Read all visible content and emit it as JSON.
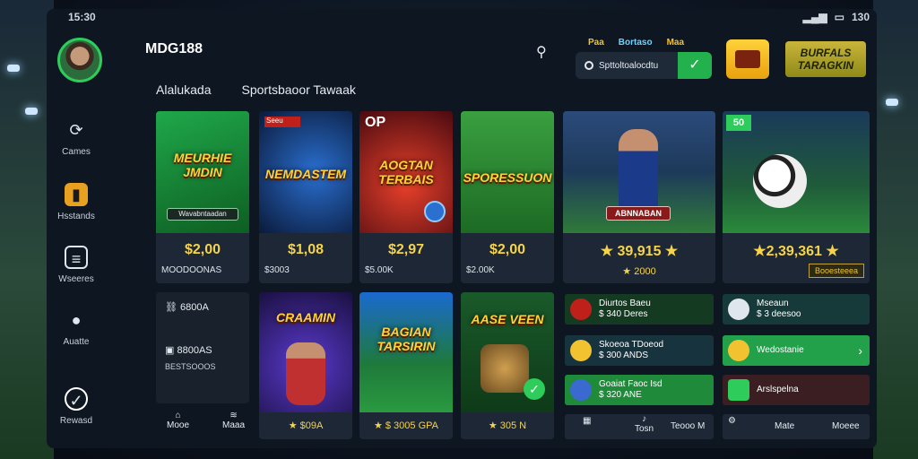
{
  "status": {
    "time": "15:30",
    "battery": "130"
  },
  "sidebar": {
    "items": [
      {
        "label": "Cames",
        "icon": "refresh-icon"
      },
      {
        "label": "Hsstands",
        "icon": "chart-icon"
      },
      {
        "label": "Wseeres",
        "icon": "list-icon"
      },
      {
        "label": "Auatte",
        "icon": "user-icon"
      },
      {
        "label": "Rewasd",
        "icon": "check-circle-icon"
      }
    ]
  },
  "header": {
    "brand": "MDG188",
    "tabs": [
      "Alalukada",
      "Sportsbaoor Tawaak"
    ],
    "promo": [
      "Paa",
      "Bortaso",
      "Maa"
    ],
    "search_value": "Spttoltoalocdtu",
    "gold_button": "BURFALS TARAGKIN"
  },
  "cards_top": [
    {
      "title": "MEURHIE JMDIN",
      "button": "Wavabntaadan",
      "price": "$2,00",
      "sub": "MOODOONAS"
    },
    {
      "title": "NEMDASTEM",
      "tag": "Seeu",
      "price": "$1,08",
      "sub": "$3003"
    },
    {
      "title": "AOGTAN TERBAIS",
      "tag": "OP",
      "price": "$2,97",
      "sub": "$5.00K"
    },
    {
      "title": "SPORESSUON",
      "price": "$2,00",
      "sub": "$2.00K"
    },
    {
      "title": "ABNNABAN",
      "price": "★ 39,915 ★",
      "sub": "★ 2000"
    },
    {
      "title": "",
      "tag": "50",
      "price": "★2,39,361 ★",
      "sub": "Booesteeea"
    }
  ],
  "cards_bottom": [
    {
      "title": "CRAAMIN",
      "meta": "★ $09A"
    },
    {
      "title": "BAGIAN TARSIRIN",
      "meta": "★ $ 3005 GPA"
    },
    {
      "title": "AASE VEEN",
      "meta": "★ 305 N"
    }
  ],
  "side_list_left": [
    {
      "label": "Diurtos Baeu",
      "sub": "$ 340 Deres"
    },
    {
      "label": "Skoeoa TDoeod",
      "sub": "$ 300 ANDS"
    },
    {
      "label": "Goaiat Faoc Isd",
      "sub": "$ 320 ANE"
    }
  ],
  "side_list_right": [
    {
      "label": "Mseaun",
      "sub": "$ 3 deesoo"
    },
    {
      "label": "Wedostanie",
      "sub": ""
    },
    {
      "label": "Arslspelna",
      "sub": ""
    }
  ],
  "left_stats": [
    {
      "icon": "link-icon",
      "label": "6800A"
    },
    {
      "icon": "box-icon",
      "label": "8800AS",
      "sub": "BESTSOOOS"
    }
  ],
  "bottom_left": [
    "Mooe",
    "Maaa"
  ],
  "bottom_right": [
    "Tosn",
    "Teooo M",
    "Mate",
    "Moeee"
  ]
}
